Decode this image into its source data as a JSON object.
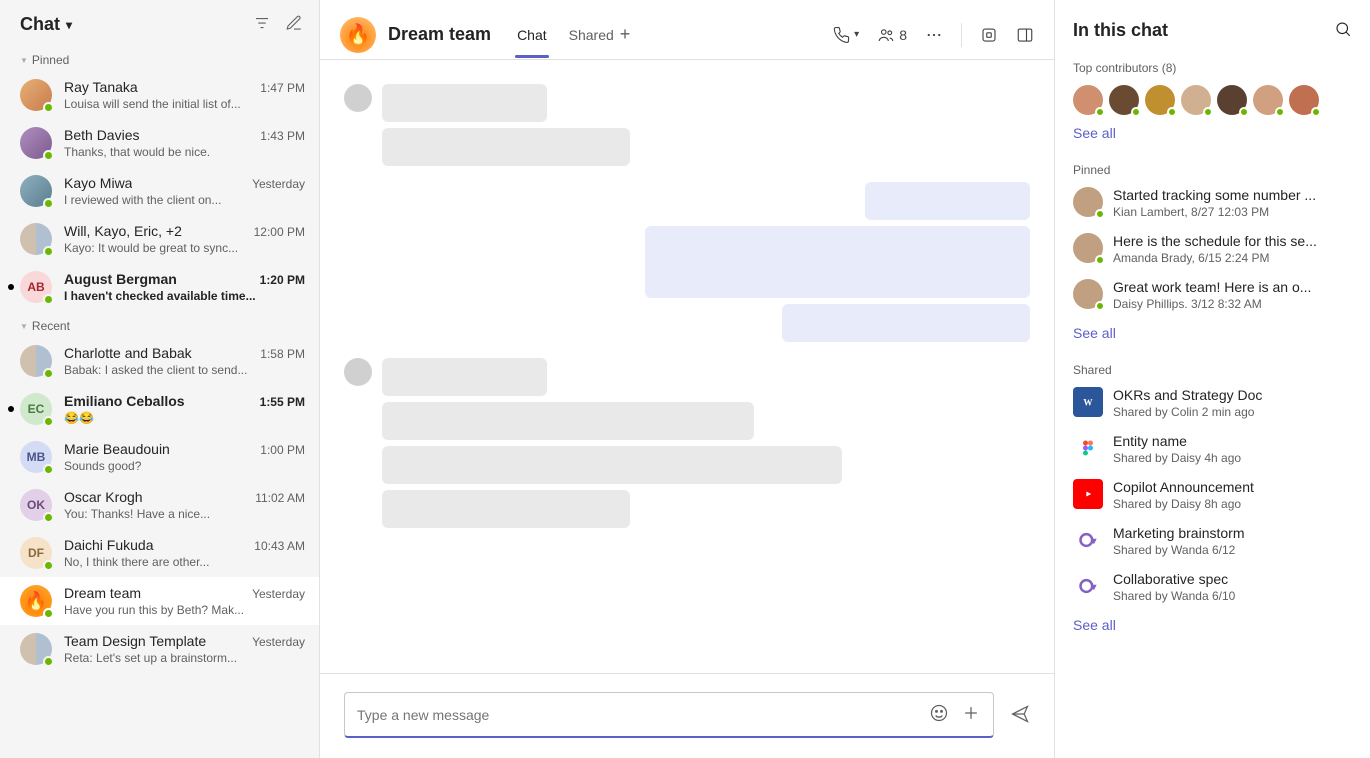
{
  "sidebar": {
    "title": "Chat",
    "sections": {
      "pinned_label": "Pinned",
      "recent_label": "Recent"
    },
    "pinned": [
      {
        "name": "Ray Tanaka",
        "preview": "Louisa will send the initial list of...",
        "time": "1:47 PM",
        "avatar_cls": "img1",
        "unread": false
      },
      {
        "name": "Beth Davies",
        "preview": "Thanks, that would be nice.",
        "time": "1:43 PM",
        "avatar_cls": "img2",
        "unread": false
      },
      {
        "name": "Kayo Miwa",
        "preview": "I reviewed with the client on...",
        "time": "Yesterday",
        "avatar_cls": "img3",
        "unread": false
      },
      {
        "name": "Will, Kayo, Eric, +2",
        "preview": "Kayo: It would be great to sync...",
        "time": "12:00 PM",
        "avatar_cls": "multi",
        "unread": false
      },
      {
        "name": "August Bergman",
        "preview": "I haven't checked available time...",
        "time": "1:20 PM",
        "avatar_cls": "ab",
        "initials": "AB",
        "unread": true,
        "show_dot": true
      }
    ],
    "recent": [
      {
        "name": "Charlotte and Babak",
        "preview": "Babak: I asked the client to send...",
        "time": "1:58 PM",
        "avatar_cls": "multi",
        "unread": false
      },
      {
        "name": "Emiliano Ceballos",
        "preview": "😂😂",
        "time": "1:55 PM",
        "avatar_cls": "ec",
        "initials": "EC",
        "unread": true,
        "show_dot": true
      },
      {
        "name": "Marie Beaudouin",
        "preview": "Sounds good?",
        "time": "1:00 PM",
        "avatar_cls": "mb",
        "initials": "MB",
        "unread": false
      },
      {
        "name": "Oscar Krogh",
        "preview": "You: Thanks! Have a nice...",
        "time": "11:02 AM",
        "avatar_cls": "ok",
        "initials": "OK",
        "unread": false
      },
      {
        "name": "Daichi Fukuda",
        "preview": "No, I think there are other...",
        "time": "10:43 AM",
        "avatar_cls": "df",
        "initials": "DF",
        "unread": false
      },
      {
        "name": "Dream team",
        "preview": "Have you run this by Beth? Mak...",
        "time": "Yesterday",
        "avatar_cls": "fire",
        "initials": "🔥",
        "unread": false,
        "active": true
      },
      {
        "name": "Team Design Template",
        "preview": "Reta: Let's set up a brainstorm...",
        "time": "Yesterday",
        "avatar_cls": "multi",
        "unread": false
      }
    ]
  },
  "main": {
    "title": "Dream team",
    "tabs": [
      {
        "label": "Chat",
        "active": true
      },
      {
        "label": "Shared",
        "active": false
      }
    ],
    "header_people_count": "8",
    "compose_placeholder": "Type a new message"
  },
  "right_panel": {
    "title": "In this chat",
    "contributors_label": "Top contributors (8)",
    "contributors_count": 7,
    "see_all_label": "See all",
    "pinned_label": "Pinned",
    "pinned": [
      {
        "title": "Started tracking some number ...",
        "sub": "Kian Lambert, 8/27 12:03 PM",
        "avatar_cls": "img4"
      },
      {
        "title": "Here is the schedule for this se...",
        "sub": "Amanda Brady, 6/15 2:24 PM",
        "avatar_cls": "img2"
      },
      {
        "title": "Great work team! Here is an o...",
        "sub": "Daisy Phillips. 3/12 8:32 AM",
        "avatar_cls": "img5"
      }
    ],
    "shared_label": "Shared",
    "shared": [
      {
        "title": "OKRs and Strategy Doc",
        "sub": "Shared by Colin 2 min ago",
        "icon": "word"
      },
      {
        "title": "Entity name",
        "sub": "Shared by Daisy 4h ago",
        "icon": "figma"
      },
      {
        "title": "Copilot Announcement",
        "sub": "Shared by Daisy 8h ago",
        "icon": "yt"
      },
      {
        "title": "Marketing brainstorm",
        "sub": "Shared by Wanda 6/12",
        "icon": "loop"
      },
      {
        "title": "Collaborative spec",
        "sub": "Shared by Wanda 6/10",
        "icon": "loop"
      }
    ]
  }
}
